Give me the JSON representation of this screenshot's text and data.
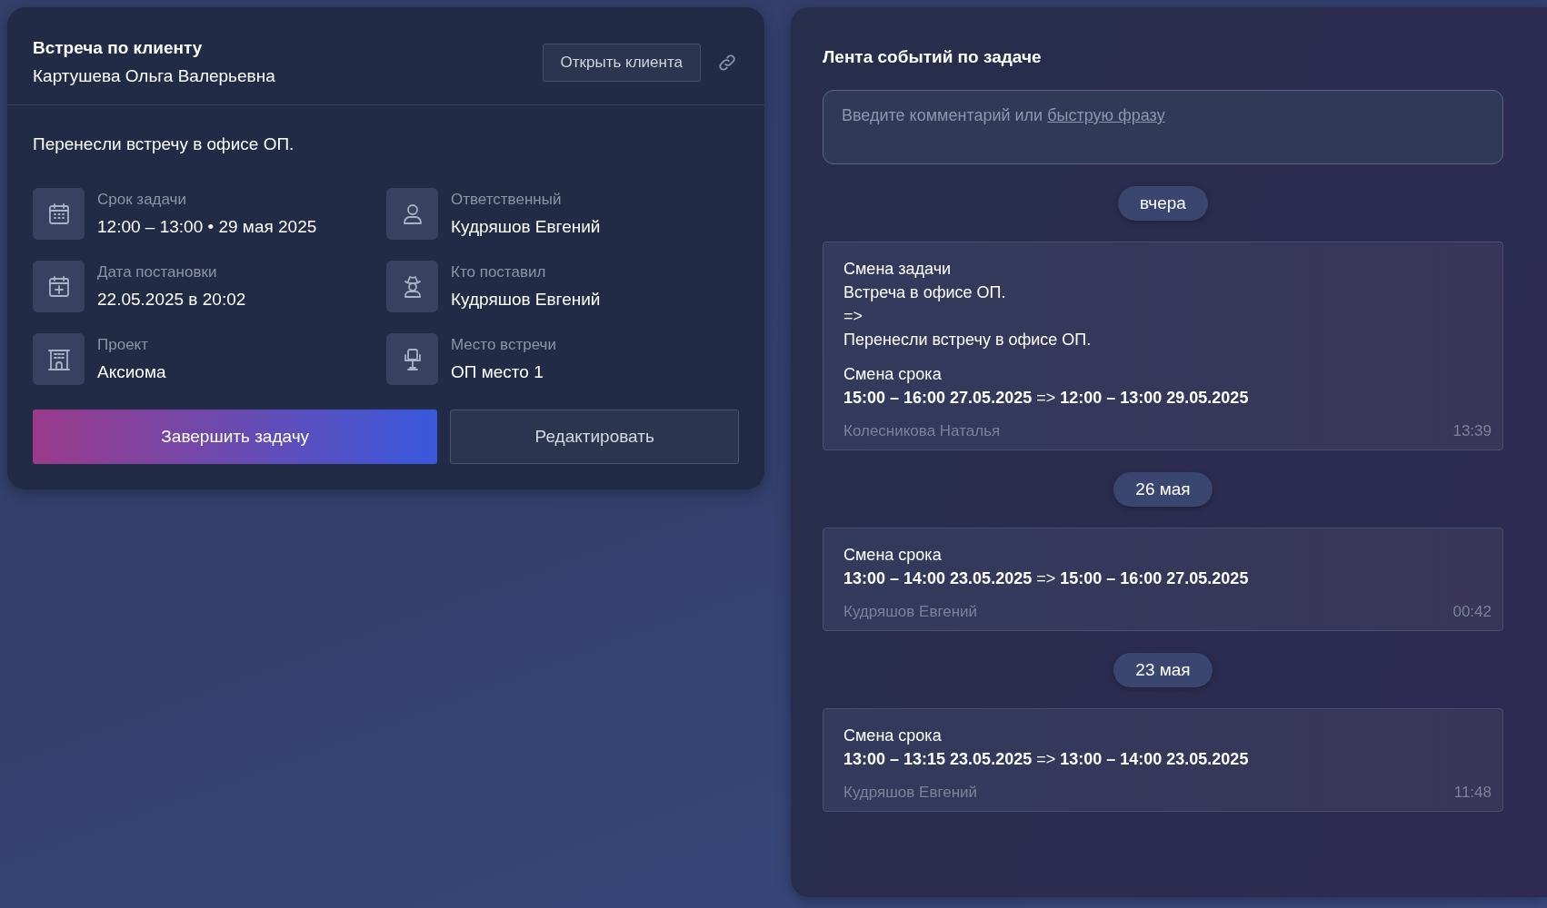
{
  "task_card": {
    "title": "Встреча по клиенту",
    "client": "Картушева Ольга Валерьевна",
    "open_client_button": "Открыть клиента",
    "description": "Перенесли встречу в офисе ОП.",
    "details": [
      {
        "label": "Срок задачи",
        "value": "12:00 – 13:00 • 29 мая 2025"
      },
      {
        "label": "Ответственный",
        "value": "Кудряшов Евгений"
      },
      {
        "label": "Дата постановки",
        "value": "22.05.2025 в 20:02"
      },
      {
        "label": "Кто поставил",
        "value": "Кудряшов Евгений"
      },
      {
        "label": "Проект",
        "value": "Аксиома"
      },
      {
        "label": "Место встречи",
        "value": "ОП место 1"
      }
    ],
    "complete_button": "Завершить задачу",
    "edit_button": "Редактировать"
  },
  "event_feed": {
    "title": "Лента событий по задаче",
    "comment_field": {
      "placeholder": "Введите комментарий или",
      "quick_phrase_link": "быструю фразу"
    },
    "groups": [
      {
        "date": "вчера",
        "events": [
          {
            "changes": [
              {
                "title": "Смена задачи",
                "lines": [
                  "Встреча в офисе ОП.",
                  "=>",
                  "Перенесли встречу в офисе ОП."
                ]
              },
              {
                "title": "Смена срока",
                "lines": [
                  "**15:00 – 16:00 27.05.2025** => **12:00 – 13:00 29.05.2025**"
                ]
              }
            ],
            "author": "Колесникова Наталья",
            "time": "13:39"
          }
        ]
      },
      {
        "date": "26 мая",
        "events": [
          {
            "changes": [
              {
                "title": "Смена срока",
                "lines": [
                  "**13:00 – 14:00 23.05.2025** => **15:00 – 16:00 27.05.2025**"
                ]
              }
            ],
            "author": "Кудряшов Евгений",
            "time": "00:42"
          }
        ]
      },
      {
        "date": "23 мая",
        "events": [
          {
            "changes": [
              {
                "title": "Смена срока",
                "lines": [
                  "**13:00 – 13:15 23.05.2025** => **13:00 – 14:00 23.05.2025**"
                ]
              }
            ],
            "author": "Кудряшов Евгений",
            "time": "11:48"
          }
        ]
      }
    ]
  }
}
